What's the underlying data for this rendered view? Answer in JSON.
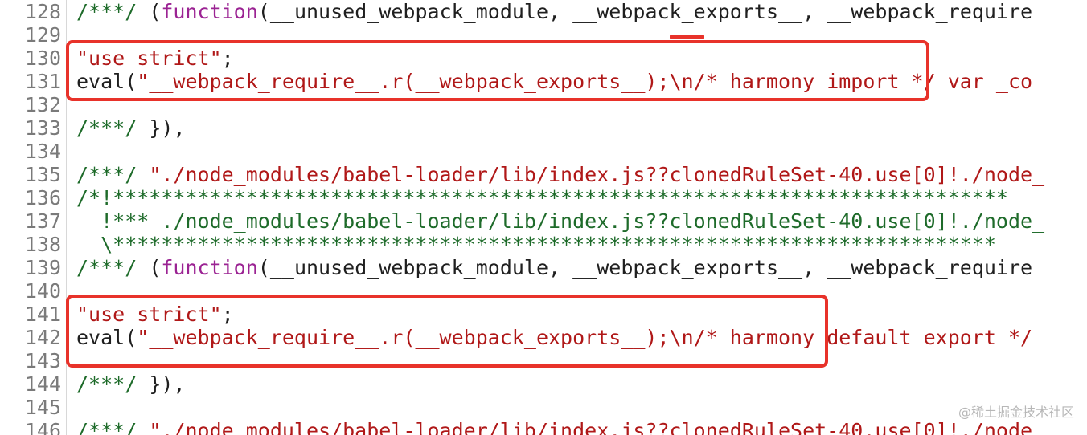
{
  "lines": [
    {
      "num": "128",
      "segments": [
        {
          "t": "/***/ ",
          "c": "cm"
        },
        {
          "t": "(",
          "c": "plain"
        },
        {
          "t": "function",
          "c": "kw"
        },
        {
          "t": "(__unused_webpack_module, __webpack_exports__, __webpack_require",
          "c": "plain"
        }
      ]
    },
    {
      "num": "129",
      "segments": []
    },
    {
      "num": "130",
      "segments": [
        {
          "t": "\"use strict\"",
          "c": "str"
        },
        {
          "t": ";",
          "c": "plain"
        }
      ]
    },
    {
      "num": "131",
      "segments": [
        {
          "t": "eval(",
          "c": "plain"
        },
        {
          "t": "\"__webpack_require__.r(__webpack_exports__);\\n/* harmony import */ var _co",
          "c": "str"
        }
      ]
    },
    {
      "num": "132",
      "segments": []
    },
    {
      "num": "133",
      "segments": [
        {
          "t": "/***/ ",
          "c": "cm"
        },
        {
          "t": "}),",
          "c": "plain"
        }
      ]
    },
    {
      "num": "134",
      "segments": []
    },
    {
      "num": "135",
      "segments": [
        {
          "t": "/***/ ",
          "c": "cm"
        },
        {
          "t": "\"./node_modules/babel-loader/lib/index.js??clonedRuleSet-40.use[0]!./node_",
          "c": "str"
        }
      ]
    },
    {
      "num": "136",
      "segments": [
        {
          "t": "/*!**************************************************************************",
          "c": "cm"
        }
      ]
    },
    {
      "num": "137",
      "segments": [
        {
          "t": "  !*** ./node_modules/babel-loader/lib/index.js??clonedRuleSet-40.use[0]!./node_",
          "c": "cm"
        }
      ]
    },
    {
      "num": "138",
      "segments": [
        {
          "t": "  \\*************************************************************************",
          "c": "cm"
        }
      ]
    },
    {
      "num": "139",
      "segments": [
        {
          "t": "/***/ ",
          "c": "cm"
        },
        {
          "t": "(",
          "c": "plain"
        },
        {
          "t": "function",
          "c": "kw"
        },
        {
          "t": "(__unused_webpack_module, __webpack_exports__, __webpack_require",
          "c": "plain"
        }
      ]
    },
    {
      "num": "140",
      "segments": []
    },
    {
      "num": "141",
      "segments": [
        {
          "t": "\"use strict\"",
          "c": "str"
        },
        {
          "t": ";",
          "c": "plain"
        }
      ]
    },
    {
      "num": "142",
      "segments": [
        {
          "t": "eval(",
          "c": "plain"
        },
        {
          "t": "\"__webpack_require__.r(__webpack_exports__);\\n/* harmony default export */",
          "c": "str"
        }
      ]
    },
    {
      "num": "143",
      "segments": []
    },
    {
      "num": "144",
      "segments": [
        {
          "t": "/***/ ",
          "c": "cm"
        },
        {
          "t": "}),",
          "c": "plain"
        }
      ]
    },
    {
      "num": "145",
      "segments": []
    },
    {
      "num": "146",
      "segments": [
        {
          "t": "/***/ ",
          "c": "cm"
        },
        {
          "t": "\"./node_modules/babel-loader/lib/index.js??clonedRuleSet-40.use[0]!./node_",
          "c": "str"
        }
      ]
    }
  ],
  "highlight_color": "#e8322a",
  "watermark": "@稀土掘金技术社区"
}
